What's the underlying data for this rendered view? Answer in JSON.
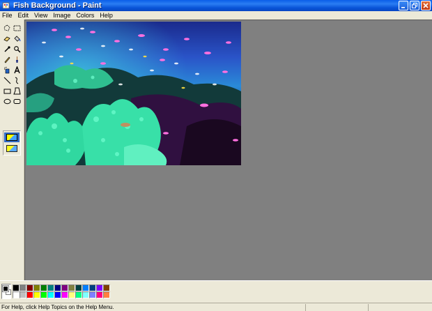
{
  "window": {
    "title": "Fish Background - Paint",
    "icon": "paint-app-icon",
    "controls": [
      "minimize-icon",
      "maximize-icon",
      "close-icon"
    ]
  },
  "menu": [
    "File",
    "Edit",
    "View",
    "Image",
    "Colors",
    "Help"
  ],
  "tools": [
    "free-form-select-icon",
    "select-icon",
    "eraser-icon",
    "fill-bucket-icon",
    "pick-color-icon",
    "magnifier-icon",
    "pencil-icon",
    "brush-icon",
    "airbrush-icon",
    "text-icon",
    "line-icon",
    "curve-icon",
    "rectangle-icon",
    "polygon-icon",
    "ellipse-icon",
    "rounded-rectangle-icon"
  ],
  "colors": {
    "foreground": "#000000",
    "background": "#ffffff",
    "palette": [
      "#000000",
      "#808080",
      "#800000",
      "#808000",
      "#008000",
      "#008080",
      "#000080",
      "#800080",
      "#808040",
      "#004040",
      "#0080ff",
      "#004080",
      "#8000ff",
      "#804000",
      "#ffffff",
      "#c0c0c0",
      "#ff0000",
      "#ffff00",
      "#00ff00",
      "#00ffff",
      "#0000ff",
      "#ff00ff",
      "#ffff80",
      "#00ff80",
      "#80ffff",
      "#8080ff",
      "#ff0080",
      "#ff8040"
    ]
  },
  "canvas": {
    "image": "underwater coral reef with tropical fish"
  },
  "status": {
    "help_text": "For Help, click Help Topics on the Help Menu."
  }
}
